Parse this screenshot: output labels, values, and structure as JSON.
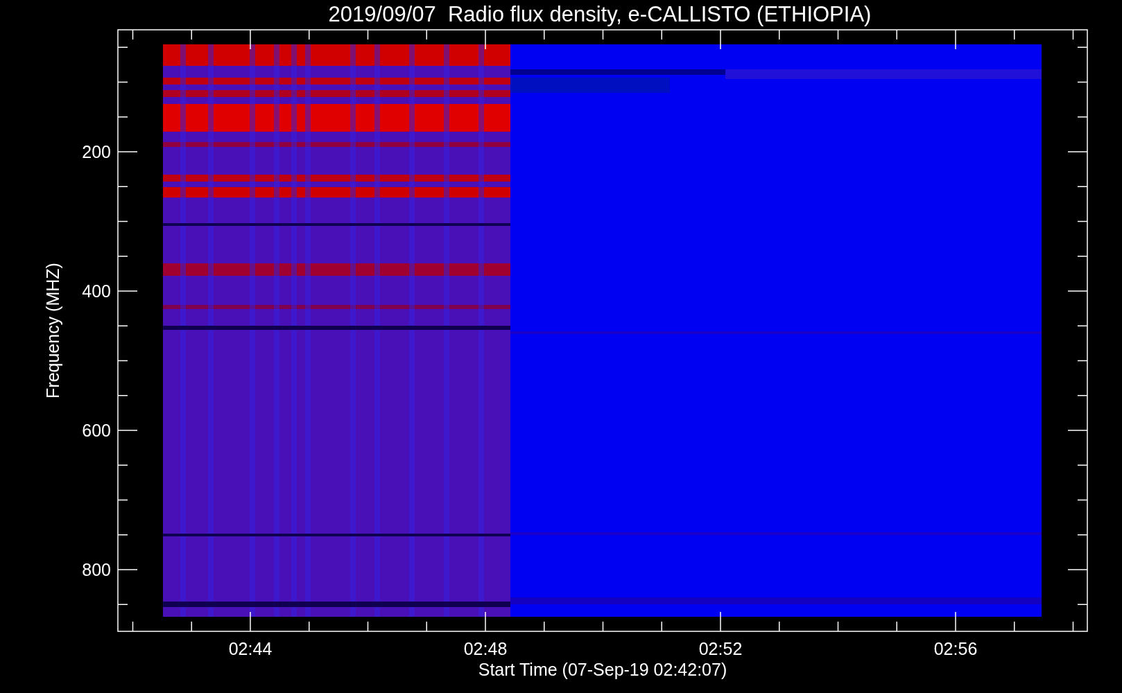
{
  "title": "2019/09/07  Radio flux density, e-CALLISTO (ETHIOPIA)",
  "ylabel": "Frequency (MHZ)",
  "xlabel": "Start Time (07-Sep-19 02:42:07)",
  "yticks": [
    "200",
    "400",
    "600",
    "800"
  ],
  "xticks": [
    "02:44",
    "02:48",
    "02:52",
    "02:56"
  ]
}
